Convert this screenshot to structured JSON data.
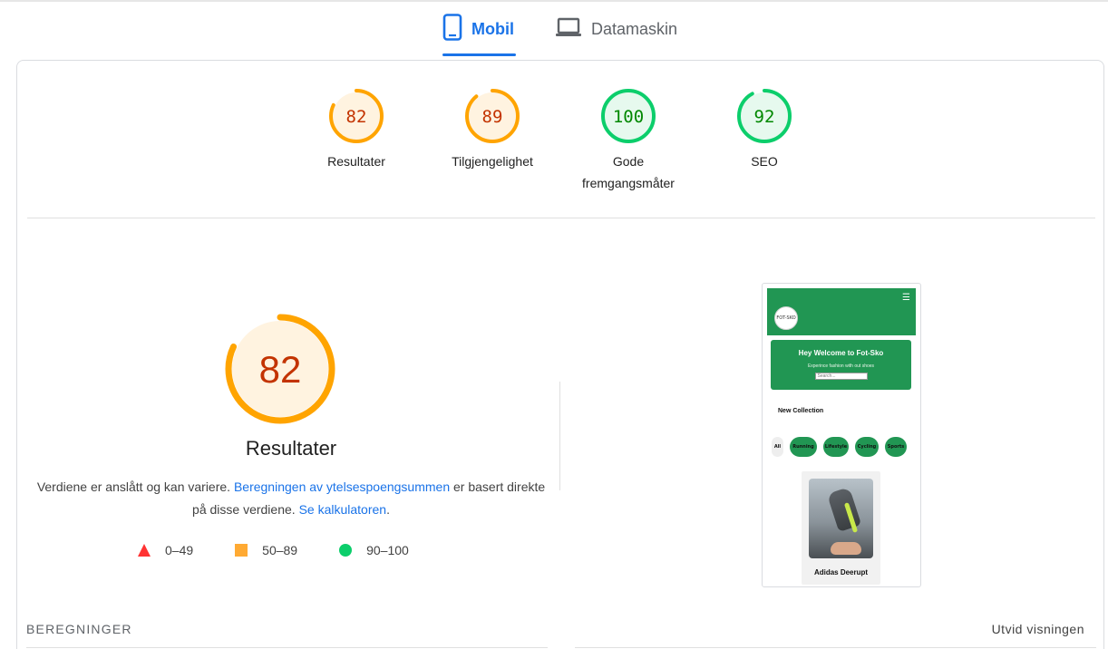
{
  "tabs": {
    "mobile": {
      "label": "Mobil",
      "icon": "phone-icon",
      "active": true
    },
    "desktop": {
      "label": "Datamaskin",
      "icon": "laptop-icon",
      "active": false
    }
  },
  "colors": {
    "accent": "#1a73e8",
    "average": "#ffa400",
    "average_text": "#c33300",
    "pass": "#0cce6b",
    "pass_text": "#008800",
    "fail": "#ff3333"
  },
  "summary": [
    {
      "score": "82",
      "label": "Resultater",
      "status": "average"
    },
    {
      "score": "89",
      "label": "Tilgjengelighet",
      "status": "average"
    },
    {
      "score": "100",
      "label": "Gode fremgangsmåter",
      "status": "pass"
    },
    {
      "score": "92",
      "label": "SEO",
      "status": "pass"
    }
  ],
  "performance": {
    "score": "82",
    "title": "Resultater",
    "desc_before": "Verdiene er anslått og kan variere. ",
    "link1": "Beregningen av ytelsespoengsummen",
    "desc_middle": " er basert direkte på disse verdiene. ",
    "link2": "Se kalkulatoren",
    "desc_after": "."
  },
  "legend": [
    {
      "range": "0–49",
      "shape": "triangle"
    },
    {
      "range": "50–89",
      "shape": "square"
    },
    {
      "range": "90–100",
      "shape": "circle"
    }
  ],
  "screenshot": {
    "logo": "FOT-SKO",
    "hero_title": "Hey Welcome to Fot-Sko",
    "hero_sub": "Experince fashion with out shoes",
    "search_placeholder": "Search...",
    "section": "New Collection",
    "filters": [
      "All",
      "Running",
      "Lifestyle",
      "Cycling",
      "Sports"
    ],
    "product": "Adidas Deerupt"
  },
  "footer": {
    "metrics": "BEREGNINGER",
    "expand": "Utvid visningen"
  }
}
